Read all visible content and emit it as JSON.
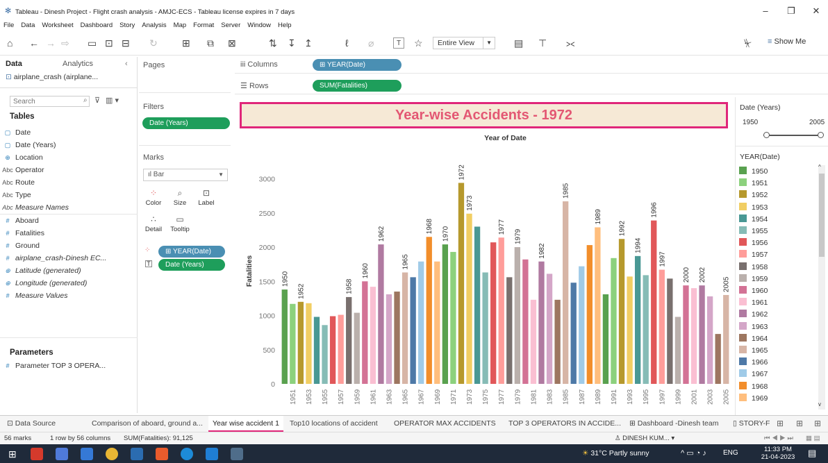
{
  "window": {
    "title": "Tableau - Dinesh Project - Flight crash analysis - AMJC-ECS - Tableau license expires in 7 days"
  },
  "menu": [
    "File",
    "Data",
    "Worksheet",
    "Dashboard",
    "Story",
    "Analysis",
    "Map",
    "Format",
    "Server",
    "Window",
    "Help"
  ],
  "toolbar": {
    "view_mode": "Entire View",
    "show_me": "Show Me"
  },
  "datapane": {
    "tab_data": "Data",
    "tab_analytics": "Analytics",
    "datasource": "airplane_crash (airplane...",
    "search_placeholder": "Search",
    "tables_heading": "Tables",
    "fields": [
      {
        "icon": "calendar-icon",
        "glyph": "▢",
        "name": "Date",
        "italic": false
      },
      {
        "icon": "calendar-icon",
        "glyph": "▢",
        "name": "Date (Years)",
        "italic": false
      },
      {
        "icon": "globe-icon",
        "glyph": "⊕",
        "name": "Location",
        "italic": false
      },
      {
        "icon": "abc-icon",
        "glyph": "Abc",
        "name": "Operator",
        "italic": false
      },
      {
        "icon": "abc-icon",
        "glyph": "Abc",
        "name": "Route",
        "italic": false
      },
      {
        "icon": "abc-icon",
        "glyph": "Abc",
        "name": "Type",
        "italic": false
      },
      {
        "icon": "abc-icon",
        "glyph": "Abc",
        "name": "Measure Names",
        "italic": true
      },
      {
        "icon": "hash-icon",
        "glyph": "#",
        "name": "Aboard",
        "italic": false
      },
      {
        "icon": "hash-icon",
        "glyph": "#",
        "name": "Fatalities",
        "italic": false
      },
      {
        "icon": "hash-icon",
        "glyph": "#",
        "name": "Ground",
        "italic": false
      },
      {
        "icon": "hash-icon",
        "glyph": "#",
        "name": "airplane_crash-Dinesh EC...",
        "italic": true
      },
      {
        "icon": "globe-icon",
        "glyph": "⊕",
        "name": "Latitude (generated)",
        "italic": true
      },
      {
        "icon": "globe-icon",
        "glyph": "⊕",
        "name": "Longitude (generated)",
        "italic": true
      },
      {
        "icon": "hash-icon",
        "glyph": "#",
        "name": "Measure Values",
        "italic": true
      }
    ],
    "parameters_heading": "Parameters",
    "parameters": [
      "Parameter TOP 3 OPERA..."
    ]
  },
  "shelves": {
    "pages": "Pages",
    "columns_label": "Columns",
    "columns_pill": "⊞ YEAR(Date)",
    "rows_label": "Rows",
    "rows_pill": "SUM(Fatalities)",
    "filters": "Filters",
    "filter_pill": "Date (Years)",
    "marks": "Marks",
    "mark_type": "Bar",
    "mark_buttons": [
      "Color",
      "Size",
      "Label",
      "Detail",
      "Tooltip"
    ],
    "mark_pills": [
      "⊞ YEAR(Date)",
      "Date (Years)"
    ]
  },
  "view": {
    "title": "Year-wise Accidents - 1972"
  },
  "chart_data": {
    "type": "bar",
    "xlabel": "Year of Date",
    "ylabel": "Fatalities",
    "ylim": [
      0,
      3300
    ],
    "yticks": [
      0,
      500,
      1000,
      1500,
      2000,
      2500,
      3000
    ],
    "categories": [
      "1950",
      "1951",
      "1952",
      "1953",
      "1954",
      "1955",
      "1956",
      "1957",
      "1958",
      "1959",
      "1960",
      "1961",
      "1962",
      "1963",
      "1964",
      "1965",
      "1966",
      "1967",
      "1968",
      "1969",
      "1970",
      "1971",
      "1972",
      "1973",
      "1974",
      "1975",
      "1976",
      "1977",
      "1978",
      "1979",
      "1980",
      "1981",
      "1982",
      "1983",
      "1984",
      "1985",
      "1986",
      "1987",
      "1988",
      "1989",
      "1990",
      "1991",
      "1992",
      "1993",
      "1994",
      "1995",
      "1996",
      "1997",
      "1998",
      "1999",
      "2000",
      "2001",
      "2002",
      "2003",
      "2004",
      "2005"
    ],
    "values": [
      1380,
      1170,
      1200,
      1180,
      980,
      860,
      990,
      1010,
      1270,
      1040,
      1500,
      1420,
      2040,
      1310,
      1350,
      1630,
      1560,
      1790,
      2150,
      1790,
      2040,
      1930,
      2940,
      2490,
      2300,
      1630,
      2070,
      2140,
      1560,
      2000,
      1820,
      1230,
      1790,
      1610,
      1230,
      2670,
      1480,
      1720,
      2030,
      2290,
      1310,
      1840,
      2120,
      1570,
      1870,
      1590,
      2390,
      1670,
      1540,
      980,
      1440,
      1400,
      1440,
      1280,
      730,
      1300
    ],
    "labeled_years": [
      "1950",
      "1952",
      "1958",
      "1960",
      "1962",
      "1965",
      "1968",
      "1970",
      "1972",
      "1973",
      "1977",
      "1979",
      "1982",
      "1985",
      "1989",
      "1992",
      "1994",
      "1996",
      "1997",
      "2000",
      "2002",
      "2005"
    ],
    "tick_labels": [
      "1951",
      "1953",
      "1955",
      "1957",
      "1959",
      "1961",
      "1963",
      "1965",
      "1967",
      "1969",
      "1971",
      "1973",
      "1975",
      "1977",
      "1979",
      "1981",
      "1983",
      "1985",
      "1987",
      "1989",
      "1991",
      "1993",
      "1995",
      "1997",
      "1999",
      "2001",
      "2003",
      "2005"
    ],
    "colors": [
      "#59a14f",
      "#8cd17d",
      "#b6992d",
      "#f1ce63",
      "#499894",
      "#86bcb6",
      "#e15759",
      "#ff9d9a",
      "#79706e",
      "#bab0ac",
      "#d37295",
      "#fabfd2",
      "#b07aa1",
      "#d4a6c8",
      "#9d7660",
      "#d7b5a6",
      "#4e79a7",
      "#a0cbe8",
      "#f28e2b",
      "#ffbe7d"
    ]
  },
  "slider": {
    "title": "Date (Years)",
    "min_label": "1950",
    "max_label": "2005"
  },
  "legend": {
    "title": "YEAR(Date)",
    "items": [
      "1950",
      "1951",
      "1952",
      "1953",
      "1954",
      "1955",
      "1956",
      "1957",
      "1958",
      "1959",
      "1960",
      "1961",
      "1962",
      "1963",
      "1964",
      "1965",
      "1966",
      "1967",
      "1968",
      "1969"
    ]
  },
  "sheet_tabs": [
    "Data Source",
    "Comparison of aboard, ground a...",
    "Year wise accident 1",
    "Top10 locations of accident",
    "OPERATOR MAX ACCIDENTS",
    "TOP 3 OPERATORS IN ACCIDE...",
    "Dashboard -Dinesh team",
    "STORY-F"
  ],
  "status": {
    "marks": "56 marks",
    "dims": "1 row by 56 columns",
    "sum": "SUM(Fatalities): 91,125",
    "user": "DINESH KUM..."
  },
  "taskbar": {
    "weather": "31°C  Partly sunny",
    "lang": "ENG",
    "time": "11:33 PM",
    "date": "21-04-2023"
  }
}
